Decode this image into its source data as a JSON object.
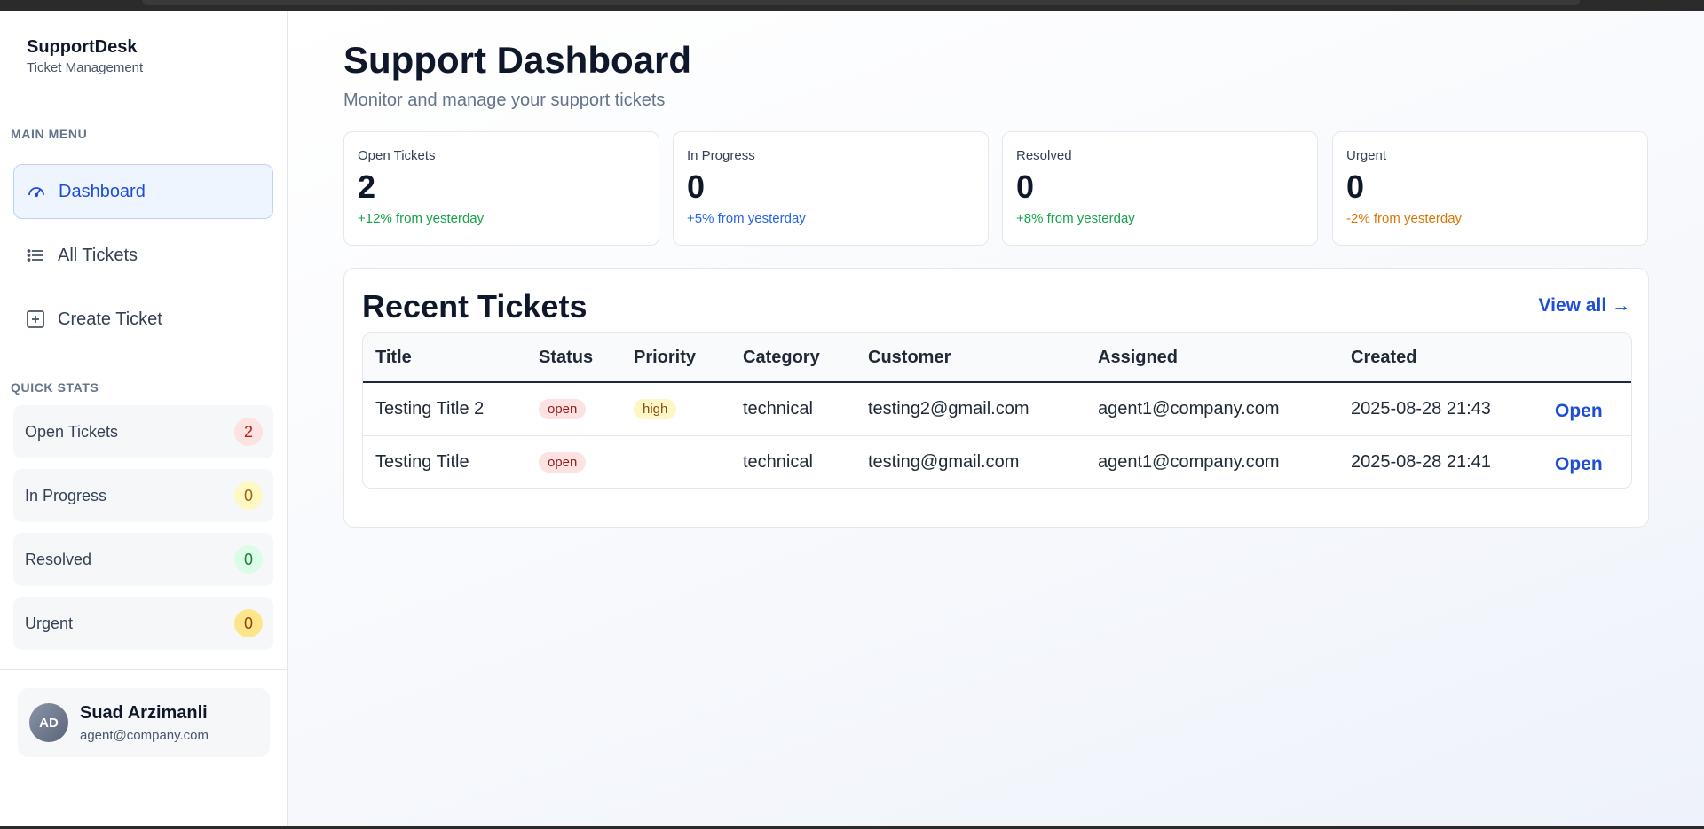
{
  "brand": {
    "name": "SupportDesk",
    "subtitle": "Ticket Management"
  },
  "sidebar": {
    "main_menu_label": "MAIN MENU",
    "nav": [
      {
        "label": "Dashboard",
        "icon": "gauge-icon",
        "active": true
      },
      {
        "label": "All Tickets",
        "icon": "list-icon",
        "active": false
      },
      {
        "label": "Create Ticket",
        "icon": "plus-square-icon",
        "active": false
      }
    ],
    "quick_stats_label": "QUICK STATS",
    "quick_stats": [
      {
        "label": "Open Tickets",
        "value": "2",
        "badge_bg": "#fde2e2",
        "badge_color": "#b91c1c"
      },
      {
        "label": "In Progress",
        "value": "0",
        "badge_bg": "#fef9c3",
        "badge_color": "#a16207"
      },
      {
        "label": "Resolved",
        "value": "0",
        "badge_bg": "#dcfce7",
        "badge_color": "#15803d"
      },
      {
        "label": "Urgent",
        "value": "0",
        "badge_bg": "#fde68a",
        "badge_color": "#92400e"
      }
    ],
    "user": {
      "initials": "AD",
      "name": "Suad Arzimanli",
      "email": "agent@company.com"
    }
  },
  "header": {
    "title": "Support Dashboard",
    "subtitle": "Monitor and manage your support tickets"
  },
  "summary_cards": [
    {
      "label": "Open Tickets",
      "value": "2",
      "delta": "+12% from yesterday",
      "delta_color": "#16a34a"
    },
    {
      "label": "In Progress",
      "value": "0",
      "delta": "+5% from yesterday",
      "delta_color": "#2563eb"
    },
    {
      "label": "Resolved",
      "value": "0",
      "delta": "+8% from yesterday",
      "delta_color": "#16a34a"
    },
    {
      "label": "Urgent",
      "value": "0",
      "delta": "-2% from yesterday",
      "delta_color": "#d97706"
    }
  ],
  "recent": {
    "title": "Recent Tickets",
    "view_all": "View all →",
    "columns": [
      "Title",
      "Status",
      "Priority",
      "Category",
      "Customer",
      "Assigned",
      "Created"
    ],
    "rows": [
      {
        "title": "Testing Title 2",
        "status": "open",
        "priority": "high",
        "category": "technical",
        "customer": "testing2@gmail.com",
        "assigned": "agent1@company.com",
        "created": "2025-08-28 21:43",
        "action": "Open"
      },
      {
        "title": "Testing Title",
        "status": "open",
        "priority": "",
        "category": "technical",
        "customer": "testing@gmail.com",
        "assigned": "agent1@company.com",
        "created": "2025-08-28 21:41",
        "action": "Open"
      }
    ]
  },
  "colors": {
    "accent": "#1d4ed8",
    "active_nav_bg": "#eef5ff"
  }
}
